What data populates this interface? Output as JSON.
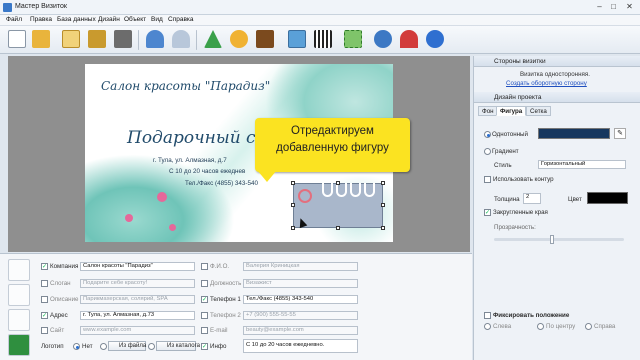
{
  "window": {
    "title": "Мастер Визиток",
    "minimize": "–",
    "maximize": "□",
    "close": "✕"
  },
  "menu": [
    "Файл",
    "Правка",
    "База данных",
    "Дизайн",
    "Объект",
    "Вид",
    "Справка"
  ],
  "card": {
    "salon": "Салон красоты \"Парадиз\"",
    "headline": "Подарочный с",
    "address": "г. Тула, ул. Алмазная, д.7",
    "hours": "С 10 до 20 часов ежеднев",
    "phone": "Тел./Факс (4855) 343-540"
  },
  "callout": {
    "line1": "Отредактируем",
    "line2": "добавленную фигуру"
  },
  "fields": {
    "company": {
      "label": "Компания",
      "value": "Салон красоты \"Парадиз\"",
      "checked": true
    },
    "slogan": {
      "label": "Слоган",
      "value": "Подарите себе красоту!",
      "checked": false
    },
    "description": {
      "label": "Описание",
      "value": "Парикмахерская, солярий, SPA",
      "checked": false
    },
    "address": {
      "label": "Адрес",
      "value": "г. Тула, ул. Алмазная, д.73",
      "checked": true
    },
    "site": {
      "label": "Сайт",
      "value": "www.example.com",
      "checked": false
    },
    "logo": {
      "label": "Логотип",
      "opt_none": "Нет",
      "from_file": "Из файла",
      "from_catalog": "Из каталога"
    },
    "fio": {
      "label": "Ф.И.О.",
      "value": "Валерия Криницкая",
      "checked": false
    },
    "position": {
      "label": "Должность",
      "value": "Визажист",
      "checked": false
    },
    "phone1": {
      "label": "Телефон 1",
      "value": "Тел./Факс (4855) 343-540",
      "checked": true
    },
    "phone2": {
      "label": "Телефон 2",
      "value": "+7 (900) 555-55-55",
      "checked": false
    },
    "email": {
      "label": "E-mail",
      "value": "beauty@example.com",
      "checked": false
    },
    "info": {
      "label": "Инфо",
      "value": "С 10 до 20 часов ежедневно.",
      "checked": true
    }
  },
  "right": {
    "sides_title": "Стороны визитки",
    "sides_info": "Визитка односторонняя.",
    "create_back": "Создать оборотную сторону",
    "design_title": "Дизайн проекта",
    "tabs": [
      "Фон",
      "Фигура",
      "Сетка"
    ],
    "solid": "Однотонный",
    "gradient": "Градиент",
    "style_label": "Стиль",
    "style_value": "Горизонтальный",
    "use_outline": "Использовать контур",
    "thickness_label": "Толщина",
    "thickness_value": "2",
    "color_label": "Цвет",
    "rounded": "Закругленные края",
    "transparency": "Прозрачность:",
    "fix_position": "Фиксировать положение",
    "align_left": "Слева",
    "align_center": "По центру",
    "align_right": "Справа"
  },
  "colors": {
    "solid_fill": "#17375e",
    "outline": "#000000",
    "callout": "#fbe321",
    "accent": "#2b6fd0"
  }
}
